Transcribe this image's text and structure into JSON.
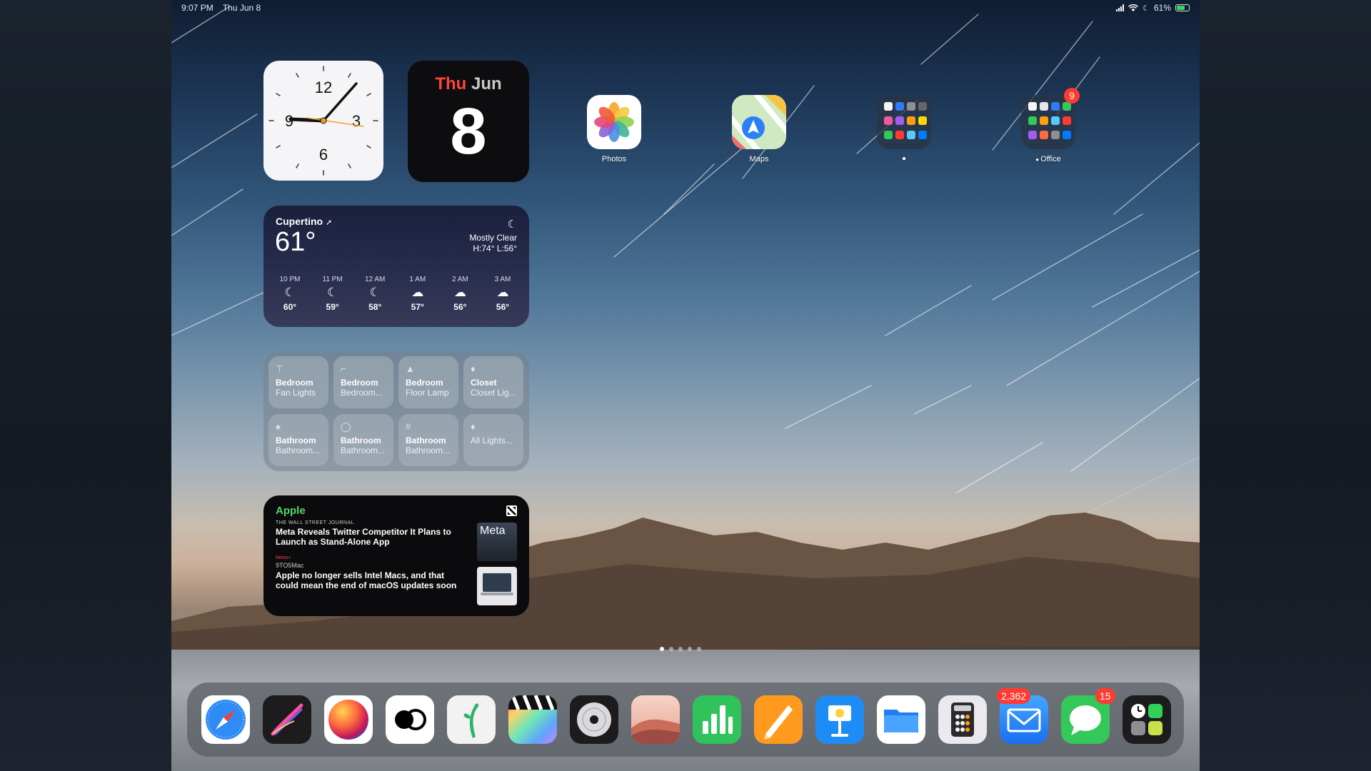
{
  "status_bar": {
    "time": "9:07 PM",
    "date": "Thu Jun 8",
    "battery": "61%"
  },
  "clock_widget": {
    "numerals": [
      "12",
      "3",
      "6",
      "9"
    ]
  },
  "calendar_widget": {
    "weekday": "Thu",
    "month": "Jun",
    "day": "8"
  },
  "weather_widget": {
    "city": "Cupertino",
    "temperature": "61°",
    "condition": "Mostly Clear",
    "high_low": "H:74° L:56°",
    "hourly": [
      {
        "time": "10 PM",
        "icon": "moon-icon",
        "temp": "60°"
      },
      {
        "time": "11 PM",
        "icon": "moon-icon",
        "temp": "59°"
      },
      {
        "time": "12 AM",
        "icon": "moon-icon",
        "temp": "58°"
      },
      {
        "time": "1 AM",
        "icon": "cloud-moon-icon",
        "temp": "57°"
      },
      {
        "time": "2 AM",
        "icon": "cloud-moon-icon",
        "temp": "56°"
      },
      {
        "time": "3 AM",
        "icon": "cloud-moon-icon",
        "temp": "56°"
      }
    ]
  },
  "home_widget": {
    "accessories": [
      {
        "room": "Bedroom",
        "name": "Fan Lights",
        "icon": "ceiling-light-icon"
      },
      {
        "room": "Bedroom",
        "name": "Bedroom...",
        "icon": "desk-lamp-icon"
      },
      {
        "room": "Bedroom",
        "name": "Floor Lamp",
        "icon": "floor-lamp-icon"
      },
      {
        "room": "Closet",
        "name": "Closet Lig...",
        "icon": "light-bulb-icon"
      },
      {
        "room": "Bathroom",
        "name": "Bathroom...",
        "icon": "table-lamp-icon"
      },
      {
        "room": "Bathroom",
        "name": "Bathroom...",
        "icon": "light-strip-icon"
      },
      {
        "room": "Bathroom",
        "name": "Bathroom...",
        "icon": "switch-icon"
      },
      {
        "room": "",
        "name": "All Lights...",
        "icon": "light-bulb-icon"
      }
    ]
  },
  "news_widget": {
    "source": "Apple",
    "items": [
      {
        "publisher": "THE WALL STREET JOURNAL",
        "headline": "Meta Reveals Twitter Competitor It Plans to Launch as Stand-Alone App",
        "thumb_text": "Meta"
      },
      {
        "publisher_tag": "News+",
        "publisher": "9TO5Mac",
        "headline": "Apple no longer sells Intel Macs, and that could mean the end of macOS updates soon"
      }
    ]
  },
  "home_apps": [
    {
      "label": "Photos",
      "icon": "photos-icon"
    },
    {
      "label": "Maps",
      "icon": "maps-icon"
    },
    {
      "label": "",
      "icon": "apple-folder-icon"
    },
    {
      "label": "Office",
      "icon": "office-folder-icon",
      "badge": "9"
    }
  ],
  "page_dots": {
    "count": 5,
    "current": 1
  },
  "dock": [
    {
      "name": "Safari",
      "icon": "safari-icon"
    },
    {
      "name": "Procreate",
      "icon": "procreate-icon"
    },
    {
      "name": "Halide",
      "icon": "color-orb-icon"
    },
    {
      "name": "Infuse",
      "icon": "rings-icon"
    },
    {
      "name": "Fantastical",
      "icon": "fern-icon"
    },
    {
      "name": "Final Cut Pro",
      "icon": "clapper-icon"
    },
    {
      "name": "Logic Pro",
      "icon": "disc-icon"
    },
    {
      "name": "Dune",
      "icon": "dunes-icon"
    },
    {
      "name": "Numbers",
      "icon": "numbers-icon"
    },
    {
      "name": "Pages",
      "icon": "pages-icon"
    },
    {
      "name": "Keynote",
      "icon": "keynote-icon"
    },
    {
      "name": "Files",
      "icon": "files-icon"
    },
    {
      "name": "Calculator",
      "icon": "calculator-icon"
    },
    {
      "name": "Mail",
      "icon": "mail-icon",
      "badge": "2,362"
    },
    {
      "name": "Messages",
      "icon": "messages-icon",
      "badge": "15"
    },
    {
      "name": "Utilities",
      "icon": "app-library-icon"
    }
  ],
  "colors": {
    "badge": "#ff3b30",
    "calendar_red": "#ff453a",
    "news_green": "#53d769"
  }
}
